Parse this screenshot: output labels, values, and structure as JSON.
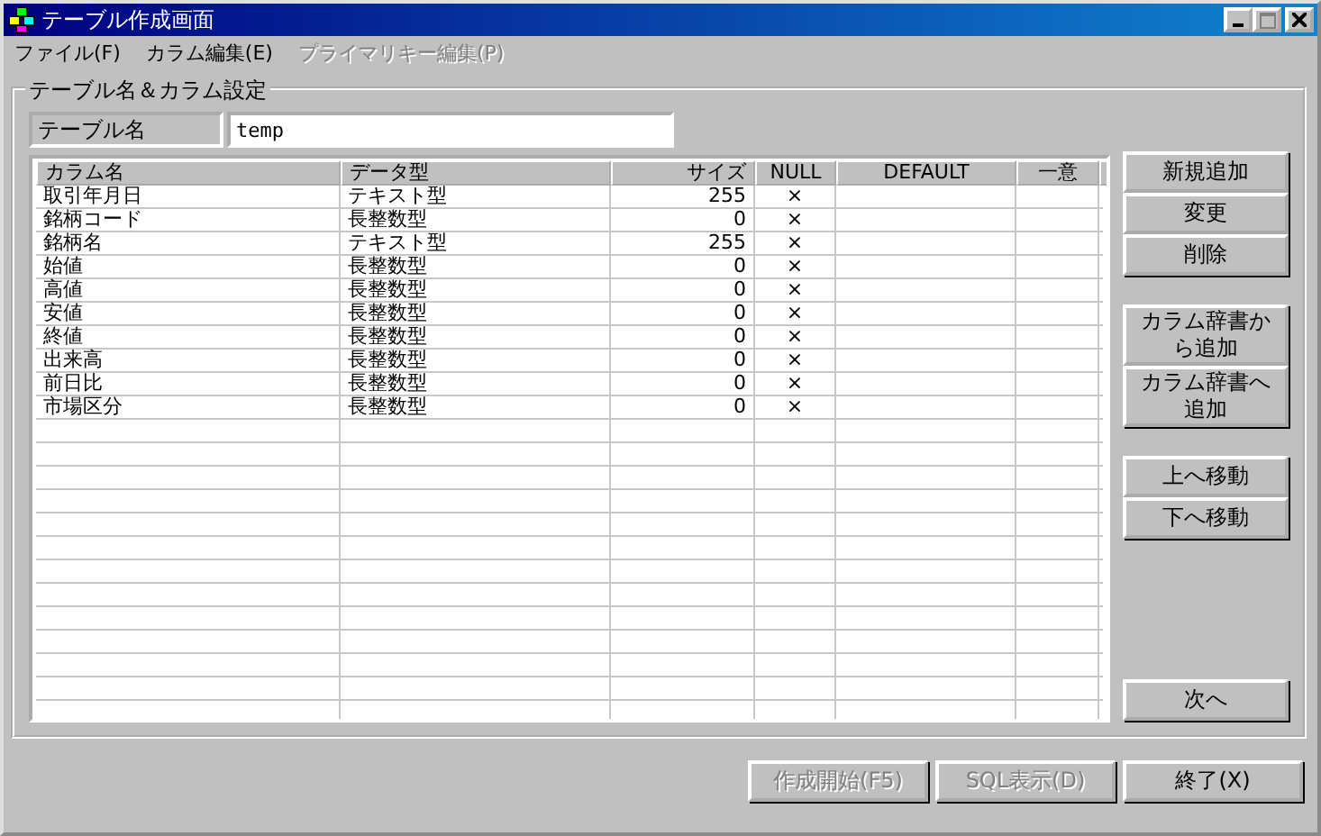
{
  "window": {
    "title": "テーブル作成画面",
    "controls": [
      {
        "kind": "minimize",
        "disabled": false
      },
      {
        "kind": "maximize",
        "disabled": true
      },
      {
        "kind": "close",
        "disabled": false
      }
    ]
  },
  "menu": [
    {
      "label": "ファイル(F)",
      "disabled": false
    },
    {
      "label": "カラム編集(E)",
      "disabled": false
    },
    {
      "label": "プライマリキー編集(P)",
      "disabled": true
    }
  ],
  "group": {
    "title": "テーブル名＆カラム設定",
    "table_name_label": "テーブル名",
    "table_name": "temp"
  },
  "table": {
    "columns": [
      {
        "label": "カラム名"
      },
      {
        "label": "データ型"
      },
      {
        "label": "サイズ"
      },
      {
        "label": "NULL"
      },
      {
        "label": "DEFAULT"
      },
      {
        "label": "一意"
      }
    ],
    "rows": [
      [
        "取引年月日",
        "テキスト型",
        "255",
        "×",
        "",
        ""
      ],
      [
        "銘柄コード",
        "長整数型",
        "0",
        "×",
        "",
        ""
      ],
      [
        "銘柄名",
        "テキスト型",
        "255",
        "×",
        "",
        ""
      ],
      [
        "始値",
        "長整数型",
        "0",
        "×",
        "",
        ""
      ],
      [
        "高値",
        "長整数型",
        "0",
        "×",
        "",
        ""
      ],
      [
        "安値",
        "長整数型",
        "0",
        "×",
        "",
        ""
      ],
      [
        "終値",
        "長整数型",
        "0",
        "×",
        "",
        ""
      ],
      [
        "出来高",
        "長整数型",
        "0",
        "×",
        "",
        ""
      ],
      [
        "前日比",
        "長整数型",
        "0",
        "×",
        "",
        ""
      ],
      [
        "市場区分",
        "長整数型",
        "0",
        "×",
        "",
        ""
      ]
    ]
  },
  "side_buttons": [
    [
      {
        "label": "新規追加"
      },
      {
        "label": "変更"
      },
      {
        "label": "削除"
      }
    ],
    [
      {
        "label": "カラム辞書から追加"
      },
      {
        "label": "カラム辞書へ追加"
      }
    ],
    [
      {
        "label": "上へ移動"
      },
      {
        "label": "下へ移動"
      }
    ]
  ],
  "next_button": "次へ",
  "bottom_buttons": [
    {
      "label": "作成開始(F5)",
      "disabled": true
    },
    {
      "label": "SQL表示(D)",
      "disabled": true
    },
    {
      "label": "終了(X)",
      "disabled": false
    }
  ]
}
